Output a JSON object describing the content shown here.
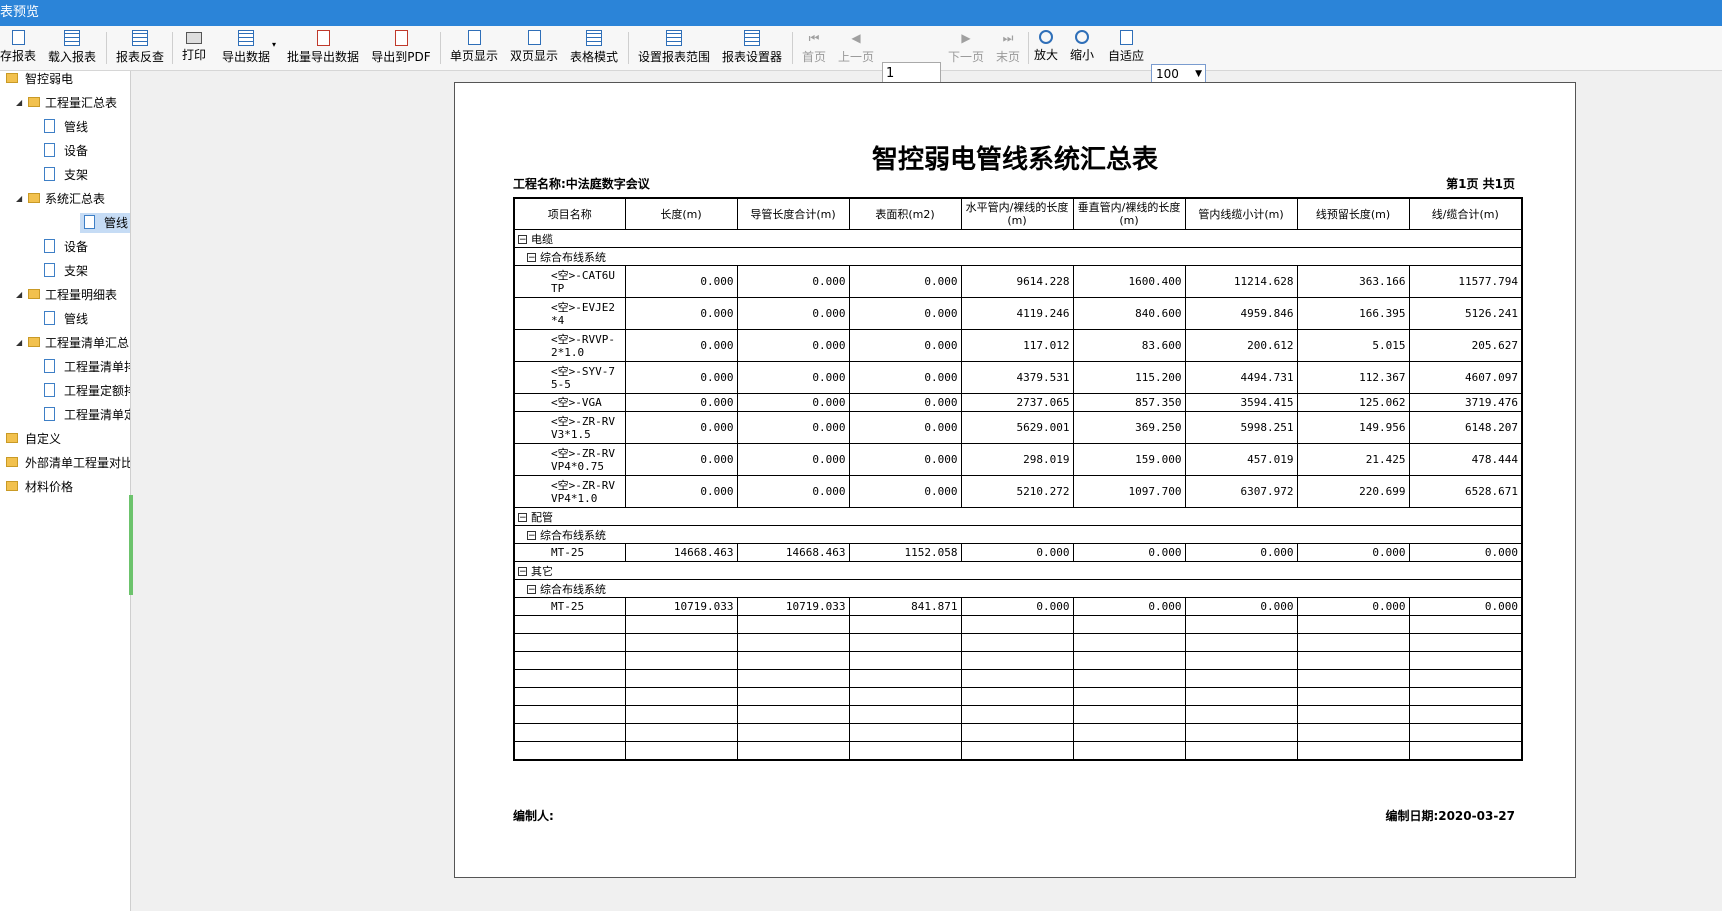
{
  "window": {
    "title": "表预览"
  },
  "toolbar": {
    "save_report": "存报表",
    "load_report": "载入报表",
    "report_query": "报表反查",
    "print": "打印",
    "export_data": "导出数据",
    "batch_export": "批量导出数据",
    "export_pdf": "导出到PDF",
    "single_page": "单页显示",
    "double_page": "双页显示",
    "table_mode": "表格模式",
    "set_range": "设置报表范围",
    "report_settings": "报表设置器",
    "first_page": "首页",
    "prev_page": "上一页",
    "page_input": "1",
    "next_page": "下一页",
    "last_page": "末页",
    "zoom_in": "放大",
    "zoom_out": "缩小",
    "fit": "自适应",
    "zoom_value": "100"
  },
  "tree": [
    {
      "label": "智控弱电",
      "level": 0,
      "type": "folder"
    },
    {
      "label": "工程量汇总表",
      "level": 1,
      "type": "folder",
      "expanded": true
    },
    {
      "label": "管线",
      "level": 2,
      "type": "page"
    },
    {
      "label": "设备",
      "level": 2,
      "type": "page"
    },
    {
      "label": "支架",
      "level": 2,
      "type": "page"
    },
    {
      "label": "系统汇总表",
      "level": 1,
      "type": "folder",
      "expanded": true
    },
    {
      "label": "管线",
      "level": 2,
      "type": "page",
      "selected": true
    },
    {
      "label": "设备",
      "level": 2,
      "type": "page"
    },
    {
      "label": "支架",
      "level": 2,
      "type": "page"
    },
    {
      "label": "工程量明细表",
      "level": 1,
      "type": "folder",
      "expanded": true
    },
    {
      "label": "管线",
      "level": 2,
      "type": "page"
    },
    {
      "label": "工程量清单汇总",
      "level": 1,
      "type": "folder",
      "expanded": true
    },
    {
      "label": "工程量清单排",
      "level": 2,
      "type": "page"
    },
    {
      "label": "工程量定额排",
      "level": 2,
      "type": "page"
    },
    {
      "label": "工程量清单定",
      "level": 2,
      "type": "page"
    },
    {
      "label": "自定义",
      "level": 0,
      "type": "folder"
    },
    {
      "label": "外部清单工程量对比",
      "level": 0,
      "type": "folder"
    },
    {
      "label": "材料价格",
      "level": 0,
      "type": "folder"
    }
  ],
  "report": {
    "title": "智控弱电管线系统汇总表",
    "project": "工程名称:中法庭数字会议",
    "page_info": "第1页 共1页",
    "prepared_by": "编制人:",
    "date": "编制日期:2020-03-27",
    "headers": [
      "项目名称",
      "长度(m)",
      "导管长度合计(m)",
      "表面积(m2)",
      "水平管内/裸线的长度(m)",
      "垂直管内/裸线的长度(m)",
      "管内线缆小计(m)",
      "线预留长度(m)",
      "线/缆合计(m)"
    ],
    "groups": [
      {
        "name": "电缆",
        "system": "综合布线系统",
        "rows": [
          {
            "name": "<空>-CAT6UTP",
            "values": [
              "0.000",
              "0.000",
              "0.000",
              "9614.228",
              "1600.400",
              "11214.628",
              "363.166",
              "11577.794"
            ]
          },
          {
            "name": "<空>-EVJE2*4",
            "values": [
              "0.000",
              "0.000",
              "0.000",
              "4119.246",
              "840.600",
              "4959.846",
              "166.395",
              "5126.241"
            ]
          },
          {
            "name": "<空>-RVVP-2*1.0",
            "values": [
              "0.000",
              "0.000",
              "0.000",
              "117.012",
              "83.600",
              "200.612",
              "5.015",
              "205.627"
            ]
          },
          {
            "name": "<空>-SYV-75-5",
            "values": [
              "0.000",
              "0.000",
              "0.000",
              "4379.531",
              "115.200",
              "4494.731",
              "112.367",
              "4607.097"
            ]
          },
          {
            "name": "<空>-VGA",
            "values": [
              "0.000",
              "0.000",
              "0.000",
              "2737.065",
              "857.350",
              "3594.415",
              "125.062",
              "3719.476"
            ]
          },
          {
            "name": "<空>-ZR-RVV3*1.5",
            "values": [
              "0.000",
              "0.000",
              "0.000",
              "5629.001",
              "369.250",
              "5998.251",
              "149.956",
              "6148.207"
            ]
          },
          {
            "name": "<空>-ZR-RVVP4*0.75",
            "values": [
              "0.000",
              "0.000",
              "0.000",
              "298.019",
              "159.000",
              "457.019",
              "21.425",
              "478.444"
            ]
          },
          {
            "name": "<空>-ZR-RVVP4*1.0",
            "values": [
              "0.000",
              "0.000",
              "0.000",
              "5210.272",
              "1097.700",
              "6307.972",
              "220.699",
              "6528.671"
            ]
          }
        ]
      },
      {
        "name": "配管",
        "system": "综合布线系统",
        "rows": [
          {
            "name": "MT-25",
            "values": [
              "14668.463",
              "14668.463",
              "1152.058",
              "0.000",
              "0.000",
              "0.000",
              "0.000",
              "0.000"
            ]
          }
        ]
      },
      {
        "name": "其它",
        "system": "综合布线系统",
        "rows": [
          {
            "name": "MT-25",
            "values": [
              "10719.033",
              "10719.033",
              "841.871",
              "0.000",
              "0.000",
              "0.000",
              "0.000",
              "0.000"
            ]
          }
        ]
      }
    ]
  }
}
